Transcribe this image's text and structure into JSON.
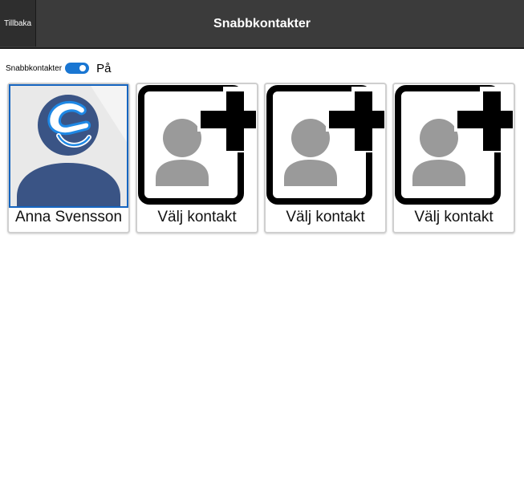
{
  "header": {
    "back_label": "Tillbaka",
    "title": "Snabbkontakter"
  },
  "quick_contacts_toggle": {
    "label": "Snabbkontakter",
    "state": "På",
    "on": true
  },
  "contacts": [
    {
      "name": "Anna Svensson",
      "icon": "contact-avatar",
      "filled": true
    },
    {
      "name": "Välj kontakt",
      "icon": "add-contact-icon",
      "filled": false
    },
    {
      "name": "Välj kontakt",
      "icon": "add-contact-icon",
      "filled": false
    },
    {
      "name": "Välj kontakt",
      "icon": "add-contact-icon",
      "filled": false
    }
  ],
  "colors": {
    "header_bg": "#3b3b3b",
    "accent": "#1976d2",
    "avatar_body": "#3a5485",
    "avatar_bg": "#e9e9e9"
  }
}
